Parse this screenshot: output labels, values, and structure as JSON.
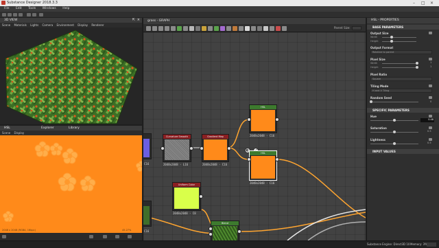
{
  "window": {
    "title": "Substance Designer 2018.3.3"
  },
  "menu": [
    "File",
    "Edit",
    "Tools",
    "Windows",
    "Help"
  ],
  "view3d": {
    "title": "3D VIEW",
    "menu": [
      "Scene",
      "Materials",
      "Lights",
      "Camera",
      "Environment",
      "Display",
      "Renderer"
    ]
  },
  "view2d": {
    "tabs": [
      "HSL",
      "Explorer",
      "Library"
    ],
    "status": "2048 x 2048 (RGBA, 16bpc)",
    "zoom": "45.27%"
  },
  "graph": {
    "title": "grass - GRAPH",
    "parent_size_label": "Parent Size:",
    "nodes": [
      {
        "id": "curvature",
        "title": "Curvature Smooth",
        "res": "2048x2048 - L16",
        "color": "#8b1f22"
      },
      {
        "id": "gradient",
        "title": "Gradient Map",
        "res": "2048x2048 - C16",
        "color": "#8b1f22"
      },
      {
        "id": "hsl_top",
        "title": "HSL",
        "res": "2048x2048 - C16",
        "color": "#3d7a2e"
      },
      {
        "id": "hsl_sel",
        "title": "HSL",
        "res": "2048x2048 - C16",
        "color": "#3d7a2e"
      },
      {
        "id": "uniform",
        "title": "Uniform Color",
        "res": "2048x2048 - C8",
        "color": "#8b1f22"
      },
      {
        "id": "blend",
        "title": "Blend",
        "res": "",
        "color": "#3d7a2e"
      },
      {
        "id": "left_a",
        "res": "C16"
      },
      {
        "id": "left_b",
        "res": "C16"
      }
    ]
  },
  "props": {
    "title": "HSL - PROPERTIES",
    "base_section": "BASE PARAMETERS",
    "output_size": {
      "label": "Output Size",
      "width": "Width",
      "height": "Height",
      "rel": "Relative to parent"
    },
    "output_format": {
      "label": "Output Format",
      "value": "Relative to parent"
    },
    "pixel_size": {
      "label": "Pixel Size",
      "width": "Width",
      "height": "Height",
      "v1": "1",
      "v2": "1"
    },
    "pixel_ratio": {
      "label": "Pixel Ratio",
      "value": "Square"
    },
    "tiling_mode": {
      "label": "Tiling Mode",
      "value": "H and V Tiling"
    },
    "random_seed": {
      "label": "Random Seed",
      "value": "0"
    },
    "specific_section": "SPECIFIC PARAMETERS",
    "hue": {
      "label": "Hue",
      "value": "0.48"
    },
    "saturation": {
      "label": "Saturation",
      "value": "0.5"
    },
    "lightness": {
      "label": "Lightness",
      "value": "0.5"
    },
    "input_section": "INPUT VALUES"
  },
  "bottombar": {
    "engine": "Substance Engine: Direct3D 10",
    "memory": "Memory: 3%"
  },
  "colors": {
    "orange": "#ff8a1a",
    "grass": "#3f7a2a",
    "node_red": "#8b1f22",
    "node_green": "#3d7a2e"
  }
}
